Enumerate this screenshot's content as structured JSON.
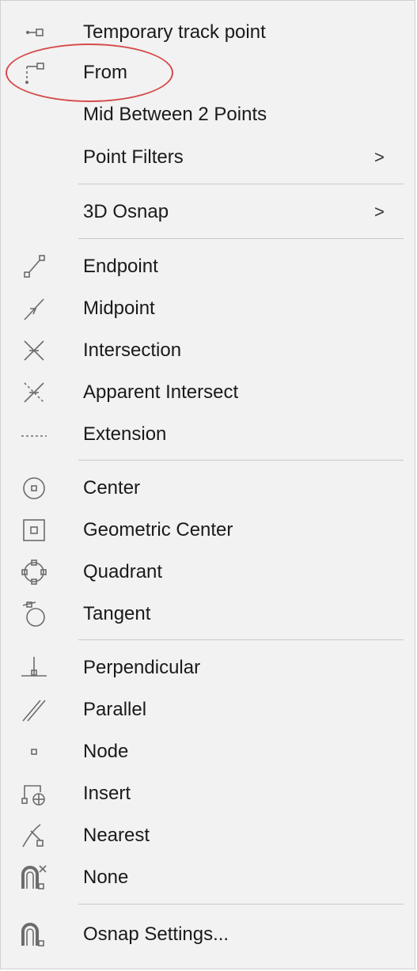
{
  "menu": {
    "items": [
      {
        "label": "Temporary track point",
        "icon": "temporary-track-point-icon"
      },
      {
        "label": "From",
        "icon": "from-icon"
      },
      {
        "label": "Mid Between 2 Points",
        "icon": ""
      },
      {
        "label": "Point Filters",
        "icon": "",
        "submenu": ">"
      },
      {
        "label": "3D Osnap",
        "icon": "",
        "submenu": ">"
      },
      {
        "label": "Endpoint",
        "icon": "endpoint-icon"
      },
      {
        "label": "Midpoint",
        "icon": "midpoint-icon"
      },
      {
        "label": "Intersection",
        "icon": "intersection-icon"
      },
      {
        "label": "Apparent Intersect",
        "icon": "apparent-intersect-icon"
      },
      {
        "label": "Extension",
        "icon": "extension-icon"
      },
      {
        "label": "Center",
        "icon": "center-icon"
      },
      {
        "label": "Geometric Center",
        "icon": "geometric-center-icon"
      },
      {
        "label": "Quadrant",
        "icon": "quadrant-icon"
      },
      {
        "label": "Tangent",
        "icon": "tangent-icon"
      },
      {
        "label": "Perpendicular",
        "icon": "perpendicular-icon"
      },
      {
        "label": "Parallel",
        "icon": "parallel-icon"
      },
      {
        "label": "Node",
        "icon": "node-icon"
      },
      {
        "label": "Insert",
        "icon": "insert-icon"
      },
      {
        "label": "Nearest",
        "icon": "nearest-icon"
      },
      {
        "label": "None",
        "icon": "none-icon"
      },
      {
        "label": "Osnap Settings...",
        "icon": "osnap-settings-icon"
      }
    ]
  },
  "colors": {
    "highlight": "#d64a4a",
    "background": "#f2f2f2"
  }
}
